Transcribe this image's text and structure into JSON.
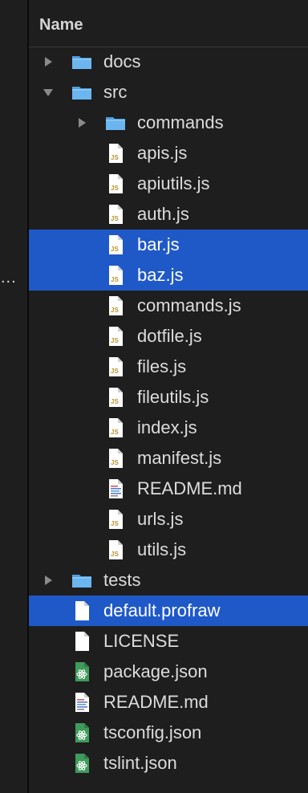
{
  "header": {
    "title": "Name"
  },
  "left_panel": {
    "overflow_text": "..."
  },
  "rows": [
    {
      "label": "docs",
      "type": "folder",
      "expanded": false,
      "depth": 0,
      "selected": false,
      "icon": "folder-icon"
    },
    {
      "label": "src",
      "type": "folder",
      "expanded": true,
      "depth": 0,
      "selected": false,
      "icon": "folder-icon"
    },
    {
      "label": "commands",
      "type": "folder",
      "expanded": false,
      "depth": 1,
      "selected": false,
      "icon": "folder-icon"
    },
    {
      "label": "apis.js",
      "type": "js",
      "depth": 1,
      "selected": false,
      "icon": "js-file-icon"
    },
    {
      "label": "apiutils.js",
      "type": "js",
      "depth": 1,
      "selected": false,
      "icon": "js-file-icon"
    },
    {
      "label": "auth.js",
      "type": "js",
      "depth": 1,
      "selected": false,
      "icon": "js-file-icon"
    },
    {
      "label": "bar.js",
      "type": "js",
      "depth": 1,
      "selected": true,
      "icon": "js-file-icon"
    },
    {
      "label": "baz.js",
      "type": "js",
      "depth": 1,
      "selected": true,
      "icon": "js-file-icon"
    },
    {
      "label": "commands.js",
      "type": "js",
      "depth": 1,
      "selected": false,
      "icon": "js-file-icon"
    },
    {
      "label": "dotfile.js",
      "type": "js",
      "depth": 1,
      "selected": false,
      "icon": "js-file-icon"
    },
    {
      "label": "files.js",
      "type": "js",
      "depth": 1,
      "selected": false,
      "icon": "js-file-icon"
    },
    {
      "label": "fileutils.js",
      "type": "js",
      "depth": 1,
      "selected": false,
      "icon": "js-file-icon"
    },
    {
      "label": "index.js",
      "type": "js",
      "depth": 1,
      "selected": false,
      "icon": "js-file-icon"
    },
    {
      "label": "manifest.js",
      "type": "js",
      "depth": 1,
      "selected": false,
      "icon": "js-file-icon"
    },
    {
      "label": "README.md",
      "type": "md",
      "depth": 1,
      "selected": false,
      "icon": "markdown-file-icon"
    },
    {
      "label": "urls.js",
      "type": "js",
      "depth": 1,
      "selected": false,
      "icon": "js-file-icon"
    },
    {
      "label": "utils.js",
      "type": "js",
      "depth": 1,
      "selected": false,
      "icon": "js-file-icon"
    },
    {
      "label": "tests",
      "type": "folder",
      "expanded": false,
      "depth": 0,
      "selected": false,
      "icon": "folder-icon"
    },
    {
      "label": "default.profraw",
      "type": "plain",
      "depth": 0,
      "selected": true,
      "icon": "blank-file-icon"
    },
    {
      "label": "LICENSE",
      "type": "plain",
      "depth": 0,
      "selected": false,
      "icon": "blank-file-icon"
    },
    {
      "label": "package.json",
      "type": "atom",
      "depth": 0,
      "selected": false,
      "icon": "atom-file-icon"
    },
    {
      "label": "README.md",
      "type": "md",
      "depth": 0,
      "selected": false,
      "icon": "markdown-file-icon"
    },
    {
      "label": "tsconfig.json",
      "type": "atom",
      "depth": 0,
      "selected": false,
      "icon": "atom-file-icon"
    },
    {
      "label": "tslint.json",
      "type": "atom",
      "depth": 0,
      "selected": false,
      "icon": "atom-file-icon"
    }
  ],
  "colors": {
    "background": "#1e1e1e",
    "selection": "#1f59c8",
    "folder": "#5aa9e6",
    "js_badge": "#c8a23a",
    "atom_green": "#3e9a5a"
  }
}
